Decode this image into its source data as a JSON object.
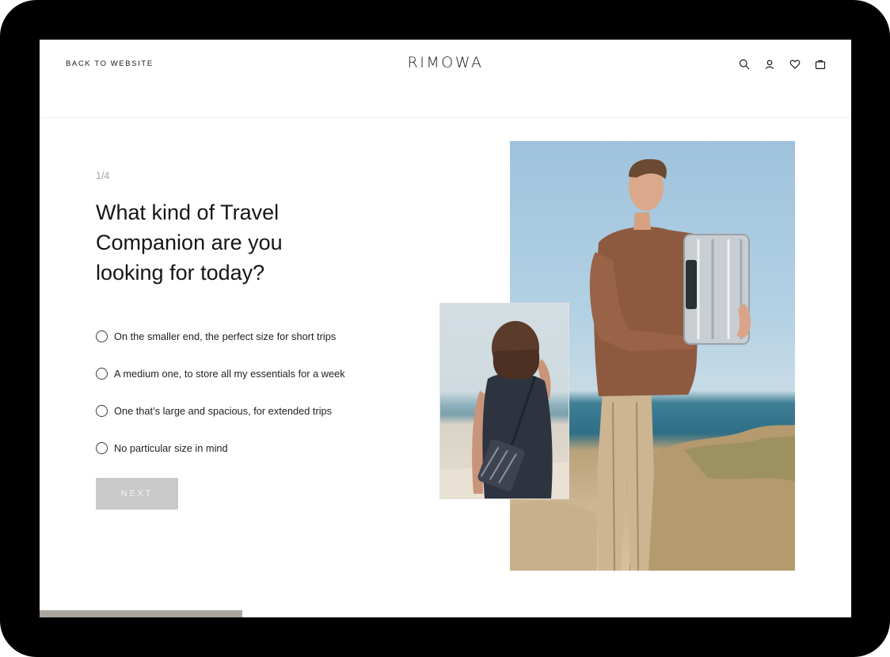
{
  "header": {
    "back_label": "BACK TO WEBSITE",
    "brand": "RIMOWA",
    "icons": [
      "search-icon",
      "account-icon",
      "wishlist-icon",
      "bag-icon"
    ]
  },
  "quiz": {
    "step": "1/4",
    "question": "What kind of Travel Companion are you looking for today?",
    "options": [
      "On the smaller end, the perfect size for short trips",
      "A medium one, to store all my essentials for a week",
      "One that’s large and spacious, for extended trips",
      "No particular size in mind"
    ],
    "next_label": "NEXT"
  },
  "colors": {
    "bezel": "#000000",
    "text": "#161616",
    "next_disabled": "#c9c9c9",
    "bottom_bar": "#aaa59e"
  }
}
